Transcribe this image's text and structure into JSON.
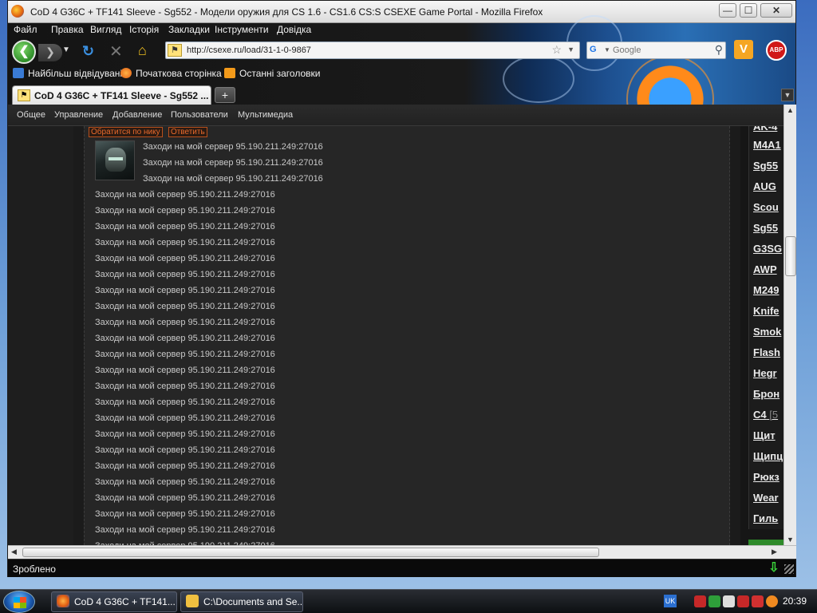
{
  "window": {
    "title": "CoD 4 G36C + TF141 Sleeve - Sg552 - Модели оружия для CS 1.6 - CS1.6 CS:S CSEXE Game Portal - Mozilla Firefox",
    "controls": {
      "minimize": "—",
      "maximize": "☐",
      "close": "✕"
    }
  },
  "menubar": [
    "Файл",
    "Правка",
    "Вигляд",
    "Історія",
    "Закладки",
    "Інструменти",
    "Довідка"
  ],
  "navigation": {
    "url": "http://csexe.ru/load/31-1-0-9867",
    "search_placeholder": "Google",
    "addon_v": "V",
    "addon_abp": "ABP"
  },
  "bookmarks": [
    "Найбільш відвідувані",
    "Початкова сторінка",
    "Останні заголовки"
  ],
  "tabs": [
    {
      "title": "CoD 4 G36C + TF141 Sleeve - Sg552 ...",
      "active": true
    }
  ],
  "site_nav": [
    "Общее",
    "Управление",
    "Добавление",
    "Пользователи",
    "Мультимедиа"
  ],
  "comment": {
    "actions": [
      "Обратится по нику",
      "Ответить"
    ],
    "message": "Заходи на мой сервер 95.190.211.249:27016"
  },
  "right_list": [
    {
      "label": "AK-4"
    },
    {
      "label": "M4A1"
    },
    {
      "label": "Sg55"
    },
    {
      "label": "AUG"
    },
    {
      "label": "Scou"
    },
    {
      "label": "Sg55"
    },
    {
      "label": "G3SG"
    },
    {
      "label": "AWP"
    },
    {
      "label": "M249"
    },
    {
      "label": "Knife"
    },
    {
      "label": "Smok"
    },
    {
      "label": "Flash"
    },
    {
      "label": "Hegr"
    },
    {
      "label": "Брон"
    },
    {
      "label": "C4",
      "count": "[5"
    },
    {
      "label": "Щит"
    },
    {
      "label": "Щипц"
    },
    {
      "label": "Рюкз"
    },
    {
      "label": "Wear"
    },
    {
      "label": "Гиль"
    }
  ],
  "status": {
    "text": "Зроблено"
  },
  "taskbar": {
    "tasks": [
      "CoD 4 G36C + TF141...",
      "C:\\Documents and Se..."
    ],
    "tray_lang": "UK",
    "clock": "20:39"
  }
}
